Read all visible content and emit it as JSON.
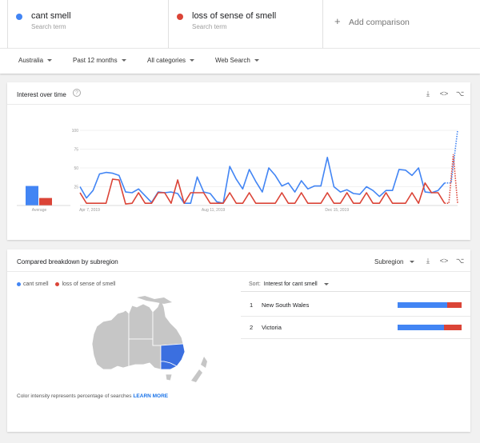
{
  "terms": [
    {
      "name": "cant smell",
      "sub": "Search term",
      "color": "#4285f4"
    },
    {
      "name": "loss of sense of smell",
      "sub": "Search term",
      "color": "#db4437"
    }
  ],
  "add_comparison": "Add comparison",
  "filters": {
    "region": "Australia",
    "time": "Past 12 months",
    "category": "All categories",
    "property": "Web Search"
  },
  "interest": {
    "title": "Interest over time",
    "help": "?"
  },
  "chart_data": {
    "type": "line",
    "title": "Interest over time",
    "xlabel": "",
    "ylabel": "",
    "ylim": [
      0,
      100
    ],
    "yticks": [
      "100",
      "75",
      "50",
      "25"
    ],
    "x_tick_labels": [
      "Apr 7, 2019",
      "Aug 11, 2019",
      "Dec 15, 2019"
    ],
    "average_label": "Average",
    "averages": [
      26,
      10
    ],
    "series": [
      {
        "name": "cant smell",
        "color": "#4285f4",
        "values": [
          25,
          10,
          20,
          42,
          44,
          43,
          40,
          18,
          17,
          22,
          13,
          4,
          18,
          17,
          18,
          16,
          3,
          3,
          38,
          18,
          16,
          5,
          3,
          52,
          35,
          22,
          48,
          32,
          18,
          50,
          40,
          26,
          30,
          18,
          33,
          22,
          26,
          26,
          64,
          25,
          18,
          21,
          16,
          15,
          25,
          20,
          12,
          20,
          20,
          48,
          47,
          40,
          50,
          18,
          17,
          20,
          30
        ],
        "partial_values": [
          30,
          100
        ]
      },
      {
        "name": "loss of sense of smell",
        "color": "#db4437",
        "values": [
          17,
          3,
          3,
          3,
          3,
          35,
          34,
          2,
          3,
          17,
          3,
          3,
          17,
          17,
          3,
          34,
          3,
          17,
          17,
          17,
          3,
          3,
          3,
          17,
          3,
          3,
          17,
          3,
          3,
          3,
          3,
          17,
          3,
          3,
          17,
          3,
          3,
          3,
          17,
          3,
          3,
          17,
          3,
          3,
          17,
          3,
          3,
          17,
          3,
          3,
          3,
          17,
          3,
          30,
          17,
          17,
          3
        ],
        "partial_values": [
          3,
          68,
          3
        ]
      }
    ]
  },
  "breakdown": {
    "title": "Compared breakdown by subregion",
    "subregion_label": "Subregion",
    "legend": [
      "cant smell",
      "loss of sense of smell"
    ],
    "sort_label": "Sort:",
    "sort_value": "Interest for cant smell",
    "footnote": "Color intensity represents percentage of searches",
    "learn_more": "LEARN MORE",
    "rows": [
      {
        "rank": "1",
        "name": "New South Wales",
        "share_a": 77,
        "share_b": 23
      },
      {
        "rank": "2",
        "name": "Victoria",
        "share_a": 73,
        "share_b": 27
      }
    ]
  }
}
